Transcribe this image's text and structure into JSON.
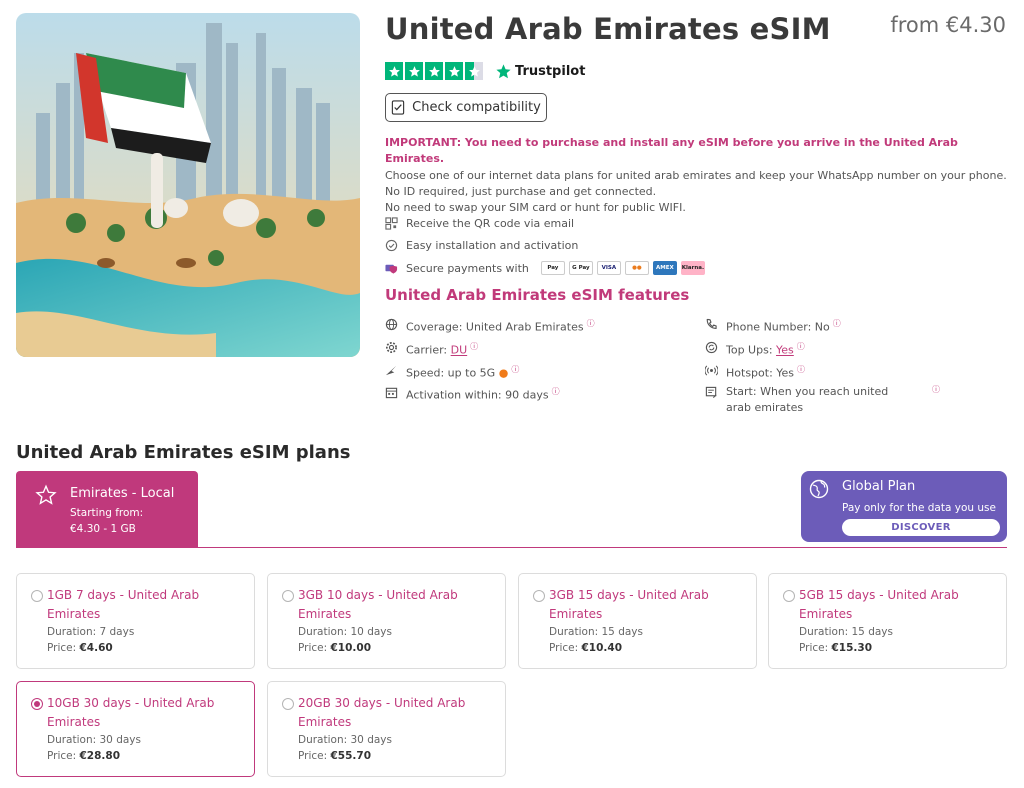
{
  "product": {
    "title": "United Arab Emirates eSIM",
    "price_from": "from €4.30",
    "trustpilot": {
      "stars": 4.5,
      "logo_text": "Trustpilot"
    },
    "check_button": "Check compatibility"
  },
  "info": {
    "important": "IMPORTANT: You need to purchase and install any eSIM before you arrive in the United Arab Emirates.",
    "line1": "Choose one of our internet data plans for united arab emirates and keep your WhatsApp number on your phone.",
    "line2": "No ID required, just purchase and get connected.",
    "line3": "No need to swap your SIM card or hunt for public WIFI."
  },
  "perks": {
    "qr": "Receive the QR code via email",
    "install": "Easy installation and activation",
    "payments": "Secure payments with",
    "payment_methods": [
      "Pay",
      "G Pay",
      "VISA",
      "●●",
      "AMEX",
      "Klarna."
    ]
  },
  "features": {
    "title": "United Arab Emirates eSIM features",
    "coverage": "Coverage: United Arab Emirates",
    "carrier_label": "Carrier:",
    "carrier_value": "DU",
    "speed": "Speed: up to 5G",
    "activation": "Activation within: 90 days",
    "phone": "Phone Number: No",
    "topups_label": "Top Ups:",
    "topups_value": "Yes",
    "hotspot": "Hotspot: Yes",
    "start": "Start: When you reach united arab emirates",
    "info_mark": "ⓘ"
  },
  "plans": {
    "title": "United Arab Emirates eSIM plans",
    "local_tab": {
      "name": "Emirates - Local",
      "starting": "Starting from:",
      "from_value": "€4.30 - 1 GB"
    },
    "global": {
      "title": "Global Plan",
      "subtitle": "Pay only for the data you use",
      "button": "DISCOVER"
    },
    "duration_prefix": "Duration:",
    "price_prefix": "Price:",
    "items": [
      {
        "name": "1GB 7 days - United Arab Emirates",
        "duration": "7 days",
        "price": "€4.60",
        "selected": false
      },
      {
        "name": "3GB 10 days - United Arab Emirates",
        "duration": "10 days",
        "price": "€10.00",
        "selected": false
      },
      {
        "name": "3GB 15 days - United Arab Emirates",
        "duration": "15 days",
        "price": "€10.40",
        "selected": false
      },
      {
        "name": "5GB 15 days - United Arab Emirates",
        "duration": "15 days",
        "price": "€15.30",
        "selected": false
      },
      {
        "name": "10GB 30 days - United Arab Emirates",
        "duration": "30 days",
        "price": "€28.80",
        "selected": true
      },
      {
        "name": "20GB 30 days - United Arab Emirates",
        "duration": "30 days",
        "price": "€55.70",
        "selected": false
      }
    ]
  },
  "colors": {
    "brand": "#c0397c",
    "global": "#6c5cb9",
    "trustpilot": "#00b67a"
  }
}
